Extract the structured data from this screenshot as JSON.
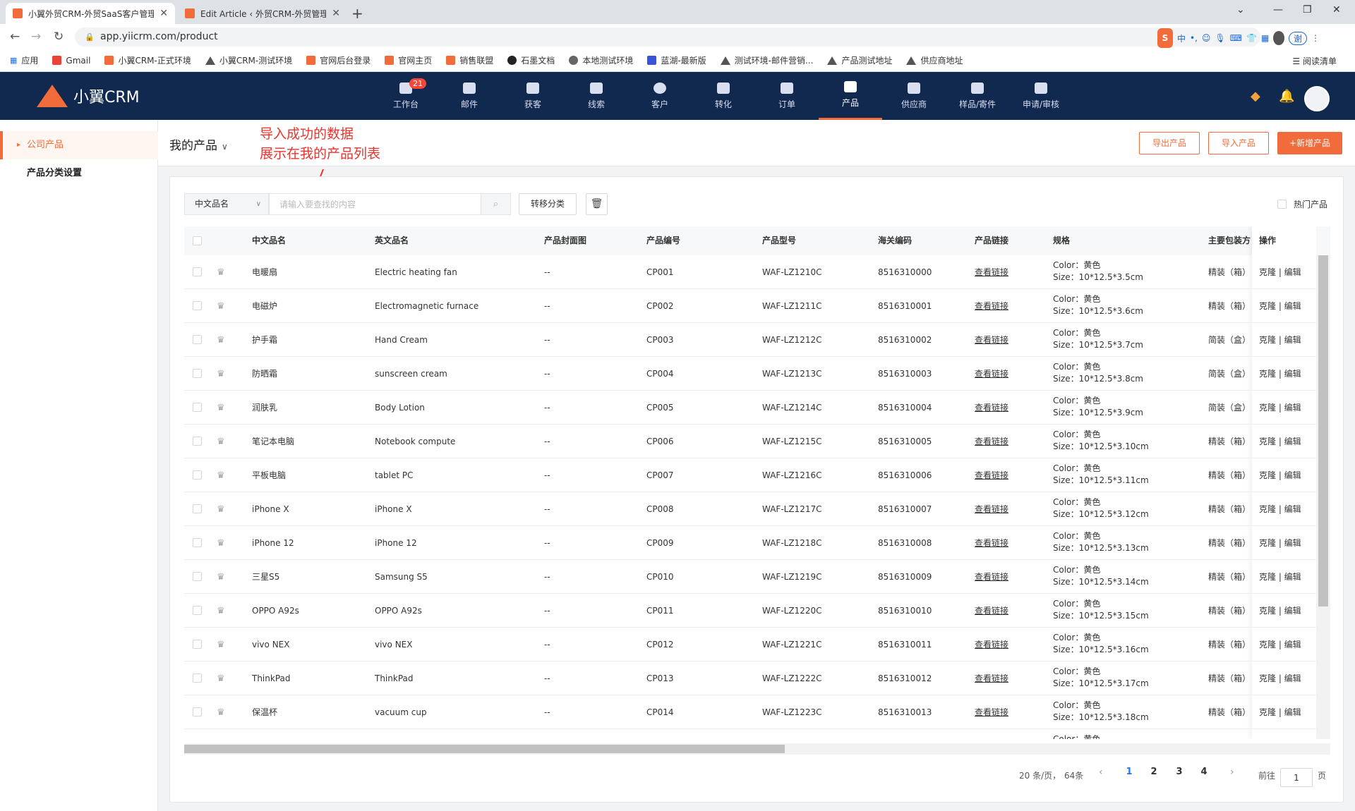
{
  "browser": {
    "tabs": [
      {
        "title": "小翼外贸CRM-外贸SaaS客户管理",
        "active": true
      },
      {
        "title": "Edit Article ‹ 外贸CRM-外贸管理",
        "active": false
      }
    ],
    "url": "app.yiicrm.com/product",
    "bookmarks": [
      "应用",
      "Gmail",
      "小翼CRM-正式环境",
      "小翼CRM-测试环境",
      "官网后台登录",
      "官网主页",
      "销售联盟",
      "石墨文档",
      "本地测试环境",
      "蓝湖-最新版",
      "测试环境-邮件营销...",
      "产品测试地址",
      "供应商地址"
    ],
    "reading_list": "阅读清单",
    "ime": {
      "logo": "S",
      "lang": "中",
      "user": "谢"
    }
  },
  "app": {
    "logo": "小翼CRM",
    "nav": [
      {
        "label": "工作台",
        "icon": "dashboard-icon",
        "badge": "21"
      },
      {
        "label": "邮件",
        "icon": "mail-icon"
      },
      {
        "label": "获客",
        "icon": "acquire-icon"
      },
      {
        "label": "线索",
        "icon": "lead-icon"
      },
      {
        "label": "客户",
        "icon": "customer-icon"
      },
      {
        "label": "转化",
        "icon": "funnel-icon"
      },
      {
        "label": "订单",
        "icon": "order-icon"
      },
      {
        "label": "产品",
        "icon": "product-icon",
        "active": true
      },
      {
        "label": "供应商",
        "icon": "supplier-icon"
      },
      {
        "label": "样品/寄件",
        "icon": "sample-icon"
      },
      {
        "label": "申请/审核",
        "icon": "approval-icon"
      }
    ]
  },
  "sidebar": {
    "items": [
      {
        "label": "公司产品",
        "active": true
      },
      {
        "label": "产品分类设置",
        "active": false
      }
    ]
  },
  "page": {
    "title": "我的产品",
    "annotation_line1": "导入成功的数据",
    "annotation_line2": "展示在我的产品列表",
    "export_label": "导出产品",
    "import_label": "导入产品",
    "add_label": "+新增产品"
  },
  "filter": {
    "field": "中文品名",
    "placeholder": "请输入要查找的内容",
    "move_label": "转移分类",
    "hot_label": "热门产品"
  },
  "table": {
    "columns": [
      "中文品名",
      "英文品名",
      "产品封面图",
      "产品编号",
      "产品型号",
      "海关编码",
      "产品链接",
      "规格",
      "主要包装方",
      "操作"
    ],
    "rows": [
      {
        "cn": "电暖扇",
        "en": "Electric heating fan",
        "cover": "--",
        "code": "CP001",
        "model": "WAF-LZ1210C",
        "hs": "8516310000",
        "link": "查看链接",
        "color": "Color：黄色",
        "size": "Size：10*12.5*3.5cm",
        "pack": "精装（箱）",
        "ops": "克隆 | 编辑"
      },
      {
        "cn": "电磁炉",
        "en": "Electromagnetic furnace",
        "cover": "--",
        "code": "CP002",
        "model": "WAF-LZ1211C",
        "hs": "8516310001",
        "link": "查看链接",
        "color": "Color：黄色",
        "size": "Size：10*12.5*3.6cm",
        "pack": "精装（箱）",
        "ops": "克隆 | 编辑"
      },
      {
        "cn": "护手霜",
        "en": "Hand Cream",
        "cover": "--",
        "code": "CP003",
        "model": "WAF-LZ1212C",
        "hs": "8516310002",
        "link": "查看链接",
        "color": "Color：黄色",
        "size": "Size：10*12.5*3.7cm",
        "pack": "简装（盒）",
        "ops": "克隆 | 编辑"
      },
      {
        "cn": "防晒霜",
        "en": "sunscreen cream",
        "cover": "--",
        "code": "CP004",
        "model": "WAF-LZ1213C",
        "hs": "8516310003",
        "link": "查看链接",
        "color": "Color：黄色",
        "size": "Size：10*12.5*3.8cm",
        "pack": "简装（盒）",
        "ops": "克隆 | 编辑"
      },
      {
        "cn": "润肤乳",
        "en": "Body Lotion",
        "cover": "--",
        "code": "CP005",
        "model": "WAF-LZ1214C",
        "hs": "8516310004",
        "link": "查看链接",
        "color": "Color：黄色",
        "size": "Size：10*12.5*3.9cm",
        "pack": "简装（盒）",
        "ops": "克隆 | 编辑"
      },
      {
        "cn": "笔记本电脑",
        "en": "Notebook compute",
        "cover": "--",
        "code": "CP006",
        "model": "WAF-LZ1215C",
        "hs": "8516310005",
        "link": "查看链接",
        "color": "Color：黄色",
        "size": "Size：10*12.5*3.10cm",
        "pack": "精装（箱）",
        "ops": "克隆 | 编辑"
      },
      {
        "cn": "平板电脑",
        "en": "tablet PC",
        "cover": "--",
        "code": "CP007",
        "model": "WAF-LZ1216C",
        "hs": "8516310006",
        "link": "查看链接",
        "color": "Color：黄色",
        "size": "Size：10*12.5*3.11cm",
        "pack": "精装（箱）",
        "ops": "克隆 | 编辑"
      },
      {
        "cn": "iPhone X",
        "en": "iPhone X",
        "cover": "--",
        "code": "CP008",
        "model": "WAF-LZ1217C",
        "hs": "8516310007",
        "link": "查看链接",
        "color": "Color：黄色",
        "size": "Size：10*12.5*3.12cm",
        "pack": "精装（箱）",
        "ops": "克隆 | 编辑"
      },
      {
        "cn": "iPhone 12",
        "en": "iPhone 12",
        "cover": "--",
        "code": "CP009",
        "model": "WAF-LZ1218C",
        "hs": "8516310008",
        "link": "查看链接",
        "color": "Color：黄色",
        "size": "Size：10*12.5*3.13cm",
        "pack": "精装（箱）",
        "ops": "克隆 | 编辑"
      },
      {
        "cn": "三星S5",
        "en": "Samsung S5",
        "cover": "--",
        "code": "CP010",
        "model": "WAF-LZ1219C",
        "hs": "8516310009",
        "link": "查看链接",
        "color": "Color：黄色",
        "size": "Size：10*12.5*3.14cm",
        "pack": "精装（箱）",
        "ops": "克隆 | 编辑"
      },
      {
        "cn": "OPPO A92s",
        "en": "OPPO A92s",
        "cover": "--",
        "code": "CP011",
        "model": "WAF-LZ1220C",
        "hs": "8516310010",
        "link": "查看链接",
        "color": "Color：黄色",
        "size": "Size：10*12.5*3.15cm",
        "pack": "精装（箱）",
        "ops": "克隆 | 编辑"
      },
      {
        "cn": "vivo NEX",
        "en": "vivo NEX",
        "cover": "--",
        "code": "CP012",
        "model": "WAF-LZ1221C",
        "hs": "8516310011",
        "link": "查看链接",
        "color": "Color：黄色",
        "size": "Size：10*12.5*3.16cm",
        "pack": "精装（箱）",
        "ops": "克隆 | 编辑"
      },
      {
        "cn": "ThinkPad",
        "en": "ThinkPad",
        "cover": "--",
        "code": "CP013",
        "model": "WAF-LZ1222C",
        "hs": "8516310012",
        "link": "查看链接",
        "color": "Color：黄色",
        "size": "Size：10*12.5*3.17cm",
        "pack": "精装（箱）",
        "ops": "克隆 | 编辑"
      },
      {
        "cn": "保温杯",
        "en": "vacuum cup",
        "cover": "--",
        "code": "CP014",
        "model": "WAF-LZ1223C",
        "hs": "8516310013",
        "link": "查看链接",
        "color": "Color：黄色",
        "size": "Size：10*12.5*3.18cm",
        "pack": "精装（箱）",
        "ops": "克隆 | 编辑"
      },
      {
        "cn": "",
        "en": "",
        "cover": "",
        "code": "",
        "model": "",
        "hs": "",
        "link": "",
        "color": "Color：黄色",
        "size": "",
        "pack": "",
        "ops": ""
      }
    ]
  },
  "pagination": {
    "per_page": "20 条/页，",
    "total": "64条",
    "pages": [
      "1",
      "2",
      "3",
      "4"
    ],
    "current": "1",
    "goto_label": "前往",
    "goto_value": "1",
    "page_unit": "页"
  },
  "colors": {
    "brand": "#f26b3a",
    "header_bg": "#11284f",
    "annotation": "#f0322b",
    "link_blue": "#1e78ff"
  }
}
